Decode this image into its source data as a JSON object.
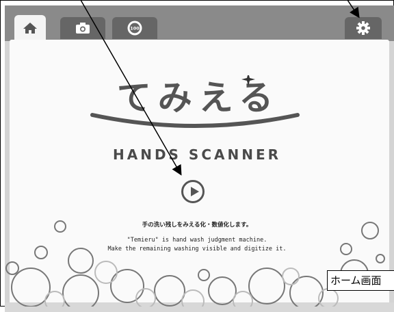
{
  "tabs": [
    {
      "icon": "home-icon",
      "active": true
    },
    {
      "icon": "camera-icon",
      "active": false
    },
    {
      "icon": "count-100-icon",
      "active": false
    }
  ],
  "tab3_badge": "100",
  "settings": {
    "icon": "gear-icon"
  },
  "logo": {
    "jp": "てみえる",
    "en": "HANDS SCANNER"
  },
  "play": {
    "icon": "play-icon"
  },
  "description": {
    "jp": "手の洗い残しをみえる化・数値化します。",
    "en_line1": "\"Temieru\" is hand wash judgment machine.",
    "en_line2": "Make the remaining washing visible and digitize it."
  },
  "caption": "ホーム画面",
  "colors": {
    "tabbar": "#8a8a8a",
    "content": "#fafafa",
    "logo": "#555555"
  }
}
